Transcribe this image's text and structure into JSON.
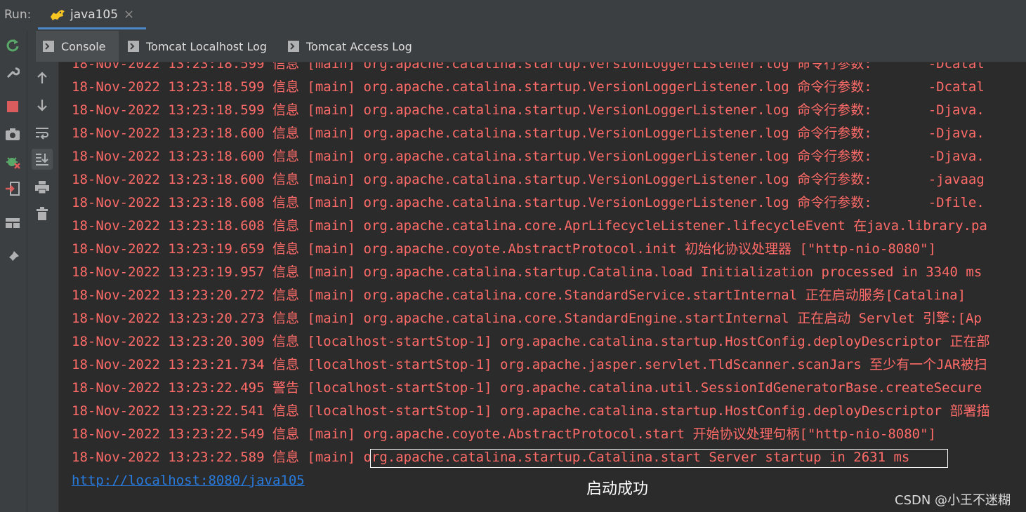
{
  "run_bar": {
    "label": "Run:",
    "tab_title": "java105",
    "close_symbol": "×",
    "icon": "tomcat-icon"
  },
  "sub_tabs": [
    {
      "label": "Console",
      "icon": "console-icon"
    },
    {
      "label": "Tomcat Localhost Log",
      "icon": "console-icon"
    },
    {
      "label": "Tomcat Access Log",
      "icon": "console-icon"
    }
  ],
  "left_toolbar": [
    "rerun-icon",
    "wrench-icon",
    "stop-icon",
    "camera-icon",
    "debug-icon",
    "login-icon",
    "layout-icon",
    "pin-icon"
  ],
  "second_toolbar": [
    "arrow-up-icon",
    "arrow-down-icon",
    "soft-wrap-icon",
    "scroll-to-end-icon",
    "print-icon",
    "trash-icon"
  ],
  "console": {
    "lines": [
      "18-Nov-2022 13:23:18.599 信息 [main] org.apache.catalina.startup.VersionLoggerListener.log 命令行参数:       -Dcatal",
      "18-Nov-2022 13:23:18.599 信息 [main] org.apache.catalina.startup.VersionLoggerListener.log 命令行参数:       -Dcatal",
      "18-Nov-2022 13:23:18.599 信息 [main] org.apache.catalina.startup.VersionLoggerListener.log 命令行参数:       -Djava.",
      "18-Nov-2022 13:23:18.600 信息 [main] org.apache.catalina.startup.VersionLoggerListener.log 命令行参数:       -Djava.",
      "18-Nov-2022 13:23:18.600 信息 [main] org.apache.catalina.startup.VersionLoggerListener.log 命令行参数:       -Djava.",
      "18-Nov-2022 13:23:18.600 信息 [main] org.apache.catalina.startup.VersionLoggerListener.log 命令行参数:       -javaag",
      "18-Nov-2022 13:23:18.608 信息 [main] org.apache.catalina.startup.VersionLoggerListener.log 命令行参数:       -Dfile.",
      "18-Nov-2022 13:23:18.608 信息 [main] org.apache.catalina.core.AprLifecycleListener.lifecycleEvent 在java.library.pa",
      "18-Nov-2022 13:23:19.659 信息 [main] org.apache.coyote.AbstractProtocol.init 初始化协议处理器 [\"http-nio-8080\"]",
      "18-Nov-2022 13:23:19.957 信息 [main] org.apache.catalina.startup.Catalina.load Initialization processed in 3340 ms",
      "18-Nov-2022 13:23:20.272 信息 [main] org.apache.catalina.core.StandardService.startInternal 正在启动服务[Catalina]",
      "18-Nov-2022 13:23:20.273 信息 [main] org.apache.catalina.core.StandardEngine.startInternal 正在启动 Servlet 引擎:[Ap",
      "18-Nov-2022 13:23:20.309 信息 [localhost-startStop-1] org.apache.catalina.startup.HostConfig.deployDescriptor 正在部",
      "18-Nov-2022 13:23:21.734 信息 [localhost-startStop-1] org.apache.jasper.servlet.TldScanner.scanJars 至少有一个JAR被扫",
      "18-Nov-2022 13:23:22.495 警告 [localhost-startStop-1] org.apache.catalina.util.SessionIdGeneratorBase.createSecure",
      "18-Nov-2022 13:23:22.541 信息 [localhost-startStop-1] org.apache.catalina.startup.HostConfig.deployDescriptor 部署描",
      "18-Nov-2022 13:23:22.549 信息 [main] org.apache.coyote.AbstractProtocol.start 开始协议处理句柄[\"http-nio-8080\"]",
      "18-Nov-2022 13:23:22.589 信息 [main] org.apache.catalina.startup.Catalina.start Server startup in 2631 ms"
    ],
    "url": "http://localhost:8080/java105"
  },
  "annotation": "启动成功",
  "watermark": "CSDN @小王不迷糊",
  "colors": {
    "log_text": "#ff6b68",
    "link": "#287bde",
    "background": "#2b2b2b",
    "toolbar": "#3c3f41"
  }
}
